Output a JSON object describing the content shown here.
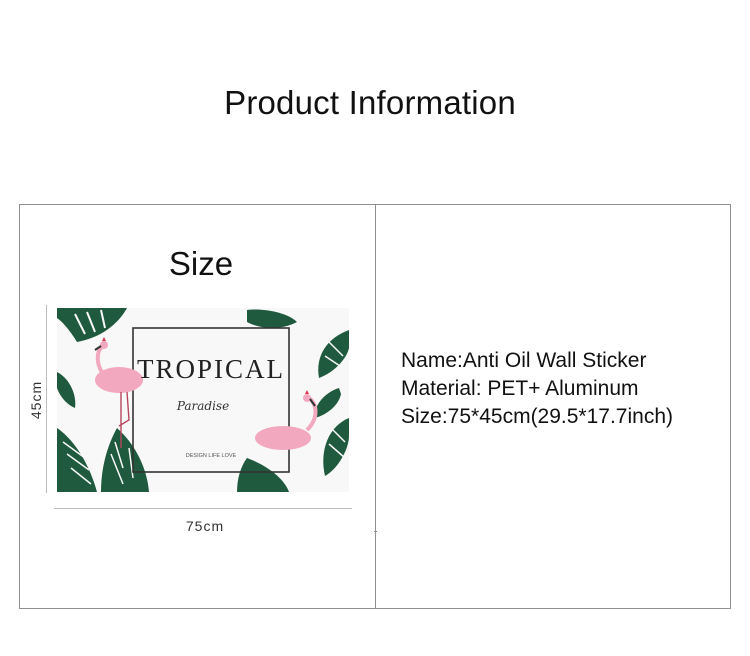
{
  "page": {
    "title": "Product Information"
  },
  "size_panel": {
    "heading": "Size",
    "width_label": "75cm",
    "height_label": "45cm",
    "image": {
      "brand_text": "TROPICAL",
      "script_text": "Paradise",
      "tagline": "DESIGN LIFE LOVE",
      "icon": "flamingo-leaf-art"
    }
  },
  "specs": {
    "name": "Name:Anti Oil Wall Sticker",
    "material": "Material: PET+ Aluminum",
    "size": "Size:75*45cm(29.5*17.7inch)"
  },
  "colors": {
    "leaf": "#1f5a3e",
    "flamingo": "#f2a9bf",
    "crown": "#e0364f",
    "border": "#8f8f8f"
  }
}
